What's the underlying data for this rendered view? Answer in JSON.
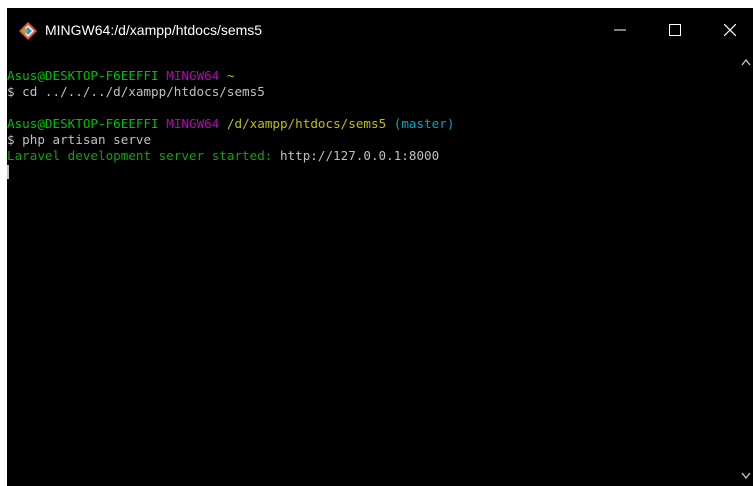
{
  "window": {
    "title": "MINGW64:/d/xampp/htdocs/sems5",
    "minimize_symbol": "—",
    "maximize_symbol": "☐",
    "close_symbol": "✕"
  },
  "colors": {
    "user_host": "#00c000",
    "system": "#c000c0",
    "path": "#c0c000",
    "branch": "#00a7c4",
    "text": "#c0c0c0",
    "server_msg": "#13a10e",
    "background": "#000000"
  },
  "icons": {
    "app": "git-bash-icon",
    "minimize": "minimize-icon",
    "maximize": "maximize-icon",
    "close": "close-icon",
    "scroll_up": "scroll-up-arrow-icon",
    "scroll_down": "scroll-down-arrow-icon"
  },
  "terminal": {
    "prompt1": {
      "user_host": "Asus@DESKTOP-F6EEFFI",
      "system": "MINGW64",
      "path": "~"
    },
    "command1": "$ cd ../../../d/xampp/htdocs/sems5",
    "prompt2": {
      "user_host": "Asus@DESKTOP-F6EEFFI",
      "system": "MINGW64",
      "path": "/d/xampp/htdocs/sems5",
      "branch": "(master)"
    },
    "command2": "$ php artisan serve",
    "output": {
      "message": "Laravel development server started:",
      "url": "http://127.0.0.1:8000"
    }
  }
}
